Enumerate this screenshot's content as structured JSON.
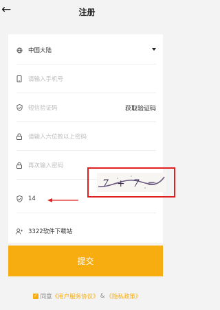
{
  "header": {
    "title": "注册",
    "back_icon": "arrow-left-icon"
  },
  "form": {
    "region": {
      "value": "中国大陆",
      "icon": "globe-icon"
    },
    "phone": {
      "placeholder": "请输入手机号",
      "icon": "phone-icon"
    },
    "sms": {
      "placeholder": "短信验证码",
      "icon": "shield-icon",
      "get_code_label": "获取验证码"
    },
    "password": {
      "placeholder": "请输入六位数以上密码",
      "icon": "lock-icon"
    },
    "password_confirm": {
      "placeholder": "再次输入密码",
      "icon": "lock-icon"
    },
    "captcha": {
      "value": "14",
      "icon": "shield-icon",
      "captcha_image_text": "7+7="
    },
    "referrer": {
      "value": "3322软件下载站",
      "icon": "user-plus-icon"
    }
  },
  "submit_label": "提交",
  "agreement": {
    "checked": true,
    "prefix": "同意",
    "terms": "《用户服务协议》",
    "amp": "&",
    "privacy": "《隐私政策》"
  },
  "colors": {
    "accent": "#f7ad10",
    "highlight": "#e02020"
  }
}
